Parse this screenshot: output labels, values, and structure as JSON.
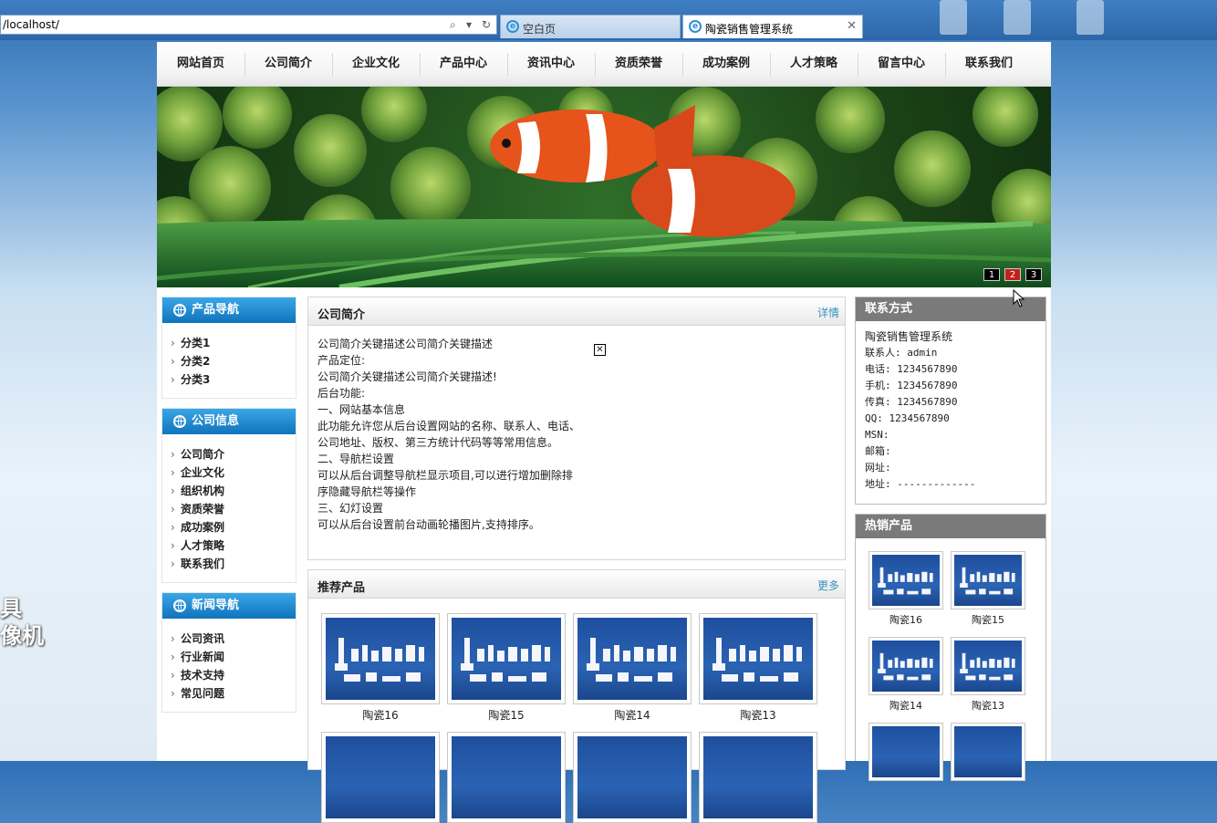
{
  "browser": {
    "address": "/localhost/",
    "tabs": [
      {
        "label": "空白页"
      },
      {
        "label": "陶瓷销售管理系统"
      }
    ]
  },
  "nav": [
    "网站首页",
    "公司简介",
    "企业文化",
    "产品中心",
    "资讯中心",
    "资质荣誉",
    "成功案例",
    "人才策略",
    "留言中心",
    "联系我们"
  ],
  "banner": {
    "slides": [
      "1",
      "2",
      "3"
    ],
    "active_index": 1
  },
  "left": {
    "product_nav": {
      "title": "产品导航",
      "items": [
        "分类1",
        "分类2",
        "分类3"
      ]
    },
    "company_info": {
      "title": "公司信息",
      "items": [
        "公司简介",
        "企业文化",
        "组织机构",
        "资质荣誉",
        "成功案例",
        "人才策略",
        "联系我们"
      ]
    },
    "news_nav": {
      "title": "新闻导航",
      "items": [
        "公司资讯",
        "行业新闻",
        "技术支持",
        "常见问题"
      ]
    }
  },
  "intro": {
    "title": "公司简介",
    "more": "详情",
    "lines": [
      "公司简介关键描述公司简介关键描述",
      "产品定位:",
      "公司简介关键描述公司简介关键描述!",
      "后台功能:",
      "一、网站基本信息",
      "此功能允许您从后台设置网站的名称、联系人、电话、",
      "公司地址、版权、第三方统计代码等等常用信息。",
      "二、导航栏设置",
      "可以从后台调整导航栏显示项目,可以进行增加删除排",
      "序隐藏导航栏等操作",
      "三、幻灯设置",
      "可以从后台设置前台动画轮播图片,支持排序。"
    ]
  },
  "recommend": {
    "title": "推荐产品",
    "more": "更多",
    "products": [
      "陶瓷16",
      "陶瓷15",
      "陶瓷14",
      "陶瓷13"
    ]
  },
  "contact": {
    "title": "联系方式",
    "company": "陶瓷销售管理系统",
    "lines": [
      "联系人: admin",
      "电话: 1234567890",
      "手机: 1234567890",
      "传真: 1234567890",
      "QQ: 1234567890",
      "MSN:",
      "邮箱:",
      "网址:",
      "地址: -------------"
    ]
  },
  "hot": {
    "title": "热销产品",
    "products": [
      "陶瓷16",
      "陶瓷15",
      "陶瓷14",
      "陶瓷13"
    ]
  },
  "watermark": "具\n像机"
}
